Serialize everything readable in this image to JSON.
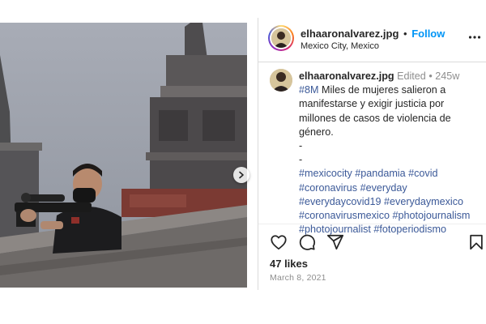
{
  "header": {
    "username": "elhaaronalvarez.jpg",
    "separator": "•",
    "follow_label": "Follow",
    "location": "Mexico City, Mexico"
  },
  "caption": {
    "username": "elhaaronalvarez.jpg",
    "edited": "Edited",
    "meta_sep": "•",
    "age": "245w",
    "lines": [
      [
        {
          "t": "#8M",
          "tag": true
        },
        {
          "t": " Miles de mujeres salieron a",
          "tag": false
        }
      ],
      [
        {
          "t": "manifestarse y exigir justicia por",
          "tag": false
        }
      ],
      [
        {
          "t": "millones de casos de violencia de",
          "tag": false
        }
      ],
      [
        {
          "t": "género.",
          "tag": false
        }
      ],
      [
        {
          "t": "-",
          "tag": false
        }
      ],
      [
        {
          "t": "-",
          "tag": false
        }
      ],
      [
        {
          "t": "#mexicocity",
          "tag": true
        },
        {
          "t": " ",
          "tag": false
        },
        {
          "t": "#pandamia",
          "tag": true
        },
        {
          "t": " ",
          "tag": false
        },
        {
          "t": "#covid",
          "tag": true
        }
      ],
      [
        {
          "t": "#coronavirus",
          "tag": true
        },
        {
          "t": " ",
          "tag": false
        },
        {
          "t": "#everyday",
          "tag": true
        }
      ],
      [
        {
          "t": "#everydaycovid19",
          "tag": true
        },
        {
          "t": " ",
          "tag": false
        },
        {
          "t": "#everydaymexico",
          "tag": true
        }
      ],
      [
        {
          "t": "#coronavirusmexico",
          "tag": true
        },
        {
          "t": " ",
          "tag": false
        },
        {
          "t": "#photojournalism",
          "tag": true
        }
      ],
      [
        {
          "t": "#photojournalist",
          "tag": true
        },
        {
          "t": " ",
          "tag": false
        },
        {
          "t": "#fotoperiodismo",
          "tag": true
        }
      ]
    ]
  },
  "stats": {
    "likes": "47 likes",
    "date": "March 8, 2021"
  },
  "icons": {
    "like": "heart-icon",
    "comment": "comment-icon",
    "share": "share-icon",
    "save": "bookmark-icon",
    "more": "more-icon",
    "next": "chevron-right-icon"
  },
  "colors": {
    "follow": "#0095f6",
    "hashtag": "#3b5998",
    "muted": "#8e8e8e",
    "text": "#262626"
  }
}
